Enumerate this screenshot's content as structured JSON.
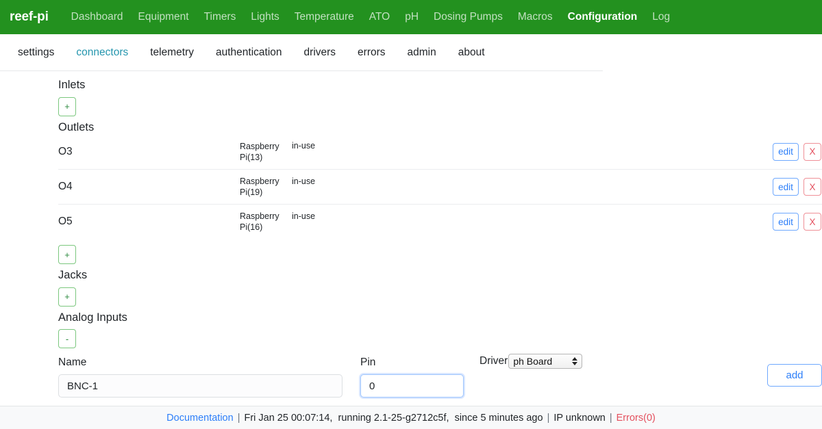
{
  "navbar": {
    "brand": "reef-pi",
    "links": [
      {
        "label": "Dashboard",
        "active": false
      },
      {
        "label": "Equipment",
        "active": false
      },
      {
        "label": "Timers",
        "active": false
      },
      {
        "label": "Lights",
        "active": false
      },
      {
        "label": "Temperature",
        "active": false
      },
      {
        "label": "ATO",
        "active": false
      },
      {
        "label": "pH",
        "active": false
      },
      {
        "label": "Dosing Pumps",
        "active": false
      },
      {
        "label": "Macros",
        "active": false
      },
      {
        "label": "Configuration",
        "active": true
      },
      {
        "label": "Log",
        "active": false
      }
    ],
    "background_color": "#23911f"
  },
  "subnav": {
    "tabs": [
      {
        "label": "settings",
        "active": false
      },
      {
        "label": "connectors",
        "active": true
      },
      {
        "label": "telemetry",
        "active": false
      },
      {
        "label": "authentication",
        "active": false
      },
      {
        "label": "drivers",
        "active": false
      },
      {
        "label": "errors",
        "active": false
      },
      {
        "label": "admin",
        "active": false
      },
      {
        "label": "about",
        "active": false
      }
    ],
    "active_color": "#2596ae"
  },
  "sections": {
    "inlets": {
      "title": "Inlets",
      "add_label": "+"
    },
    "outlets": {
      "title": "Outlets",
      "add_label": "+",
      "rows": [
        {
          "name": "O3",
          "driver": "Raspberry Pi(13)",
          "status": "in-use",
          "edit_label": "edit",
          "delete_label": "X"
        },
        {
          "name": "O4",
          "driver": "Raspberry Pi(19)",
          "status": "in-use",
          "edit_label": "edit",
          "delete_label": "X"
        },
        {
          "name": "O5",
          "driver": "Raspberry Pi(16)",
          "status": "in-use",
          "edit_label": "edit",
          "delete_label": "X"
        }
      ]
    },
    "jacks": {
      "title": "Jacks",
      "add_label": "+"
    },
    "analog_inputs": {
      "title": "Analog Inputs",
      "collapse_label": "-",
      "form": {
        "name_label": "Name",
        "name_value": "BNC-1",
        "pin_label": "Pin",
        "pin_value": "0",
        "driver_label": "Driver",
        "driver_value": "ph Board",
        "add_label": "add"
      }
    }
  },
  "footer": {
    "documentation": "Documentation",
    "sep1": "|",
    "status": "Fri Jan 25 00:07:14,  running 2.1-25-g2712c5f,  since 5 minutes ago",
    "sep2": "|",
    "ip": "IP unknown",
    "sep3": "|",
    "errors": "Errors(0)"
  }
}
